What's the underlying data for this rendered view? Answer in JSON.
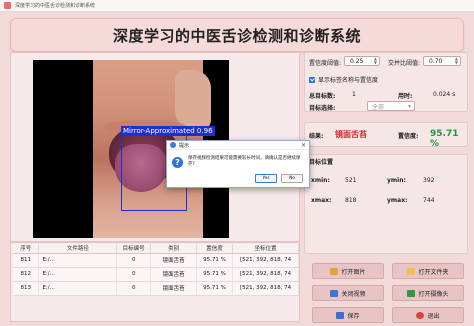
{
  "window": {
    "title": "深度学习的中医舌诊检测和诊断系统"
  },
  "banner": {
    "title": "深度学习的中医舌诊检测和诊断系统"
  },
  "detection_overlay": {
    "label": "Mirror-Approximated 0.96",
    "color": "#1f2fd6"
  },
  "settings": {
    "conf_label": "置信度阈值:",
    "conf_value": "0.25",
    "iou_label": "交并比阈值:",
    "iou_value": "0.70",
    "show_label": "显示标签名称与置信度"
  },
  "stats": {
    "total_label": "总目标数:",
    "total_value": "1",
    "time_label": "用时:",
    "time_value": "0.024 s",
    "select_label": "目标选择:",
    "select_value": "全部"
  },
  "result": {
    "result_label": "结果:",
    "result_value": "镜面舌苔",
    "conf_label": "置信度:",
    "conf_value": "95.71 %",
    "result_color": "#d12a2a",
    "conf_color": "#1c9a3a"
  },
  "position": {
    "title": "目标位置",
    "xmin_label": "xmin:",
    "xmin_value": "521",
    "ymin_label": "ymin:",
    "ymin_value": "392",
    "xmax_label": "xmax:",
    "xmax_value": "818",
    "ymax_label": "ymax:",
    "ymax_value": "744"
  },
  "table": {
    "headers": [
      "序号",
      "文件路径",
      "目标编号",
      "类别",
      "置信度",
      "坐标位置"
    ],
    "rows": [
      [
        "811",
        "E:/...",
        "0",
        "镜面舌苔",
        "95.71 %",
        "[521, 392, 818, 74"
      ],
      [
        "812",
        "E:/...",
        "0",
        "镜面舌苔",
        "95.71 %",
        "[521, 392, 818, 74"
      ],
      [
        "813",
        "E:/...",
        "0",
        "镜面舌苔",
        "95.71 %",
        "[521, 392, 818, 74"
      ]
    ]
  },
  "buttons": {
    "open_image": "打开图片",
    "open_folder": "打开文件夹",
    "close_video": "关闭视频",
    "open_camera": "打开摄像头",
    "save": "保存",
    "exit": "退出"
  },
  "dialog": {
    "title": "提示",
    "message": "保存视频检测结果可能需要较长时间，请确认是否继续保存?",
    "yes": "Yes",
    "no": "No"
  },
  "colors": {
    "accent": "#e9c4c6",
    "background": "#f3dada",
    "box": "#1f2fd6"
  }
}
